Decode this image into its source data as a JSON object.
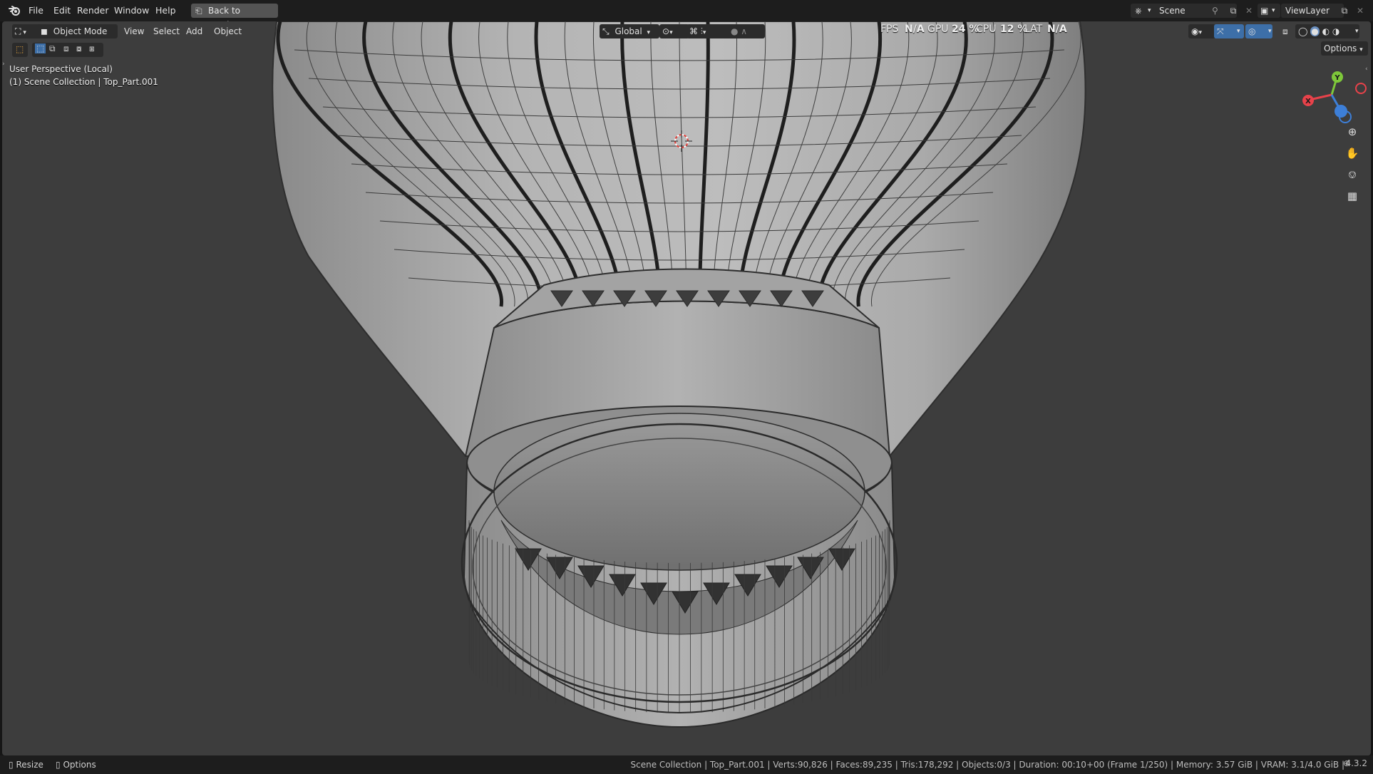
{
  "topbar": {
    "menus": [
      "File",
      "Edit",
      "Render",
      "Window",
      "Help"
    ],
    "back_button": "Back to Previous",
    "scene_label": "Scene",
    "viewlayer_label": "ViewLayer"
  },
  "viewport_header": {
    "mode": "Object Mode",
    "menus": [
      "View",
      "Select",
      "Add",
      "Object"
    ],
    "transform_orientation": "Global",
    "options": "Options"
  },
  "perf": {
    "fps_label": "FPS",
    "fps_value": "N/A",
    "gpu_label": "GPU",
    "gpu_value": "24 %",
    "cpu_label": "CPU",
    "cpu_value": "12 %",
    "lat_label": "LAT",
    "lat_value": "N/A"
  },
  "overlay": {
    "view_name": "User Perspective (Local)",
    "collection": "(1) Scene Collection | Top_Part.001"
  },
  "gizmo": {
    "x_label": "X",
    "y_label": "Y",
    "colors": {
      "x": "#e8424a",
      "y": "#7ec83a",
      "z": "#3d7fd8"
    }
  },
  "icons": {
    "blender": "blender-logo-icon",
    "editor_type": "view3d-editor-icon",
    "zoom": "zoom-icon",
    "pan": "hand-pan-icon",
    "camera": "camera-view-icon",
    "grid": "orthographic-grid-icon"
  },
  "statusbar": {
    "resize_label": "Resize",
    "options_label": "Options",
    "stats": "Scene Collection | Top_Part.001 | Verts:90,826 | Faces:89,235 | Tris:178,292 | Objects:0/3 | Duration: 00:10+00 (Frame 1/250) | Memory: 3.57 GiB | VRAM: 3.1/4.0 GiB |",
    "version": "4.3.2"
  }
}
